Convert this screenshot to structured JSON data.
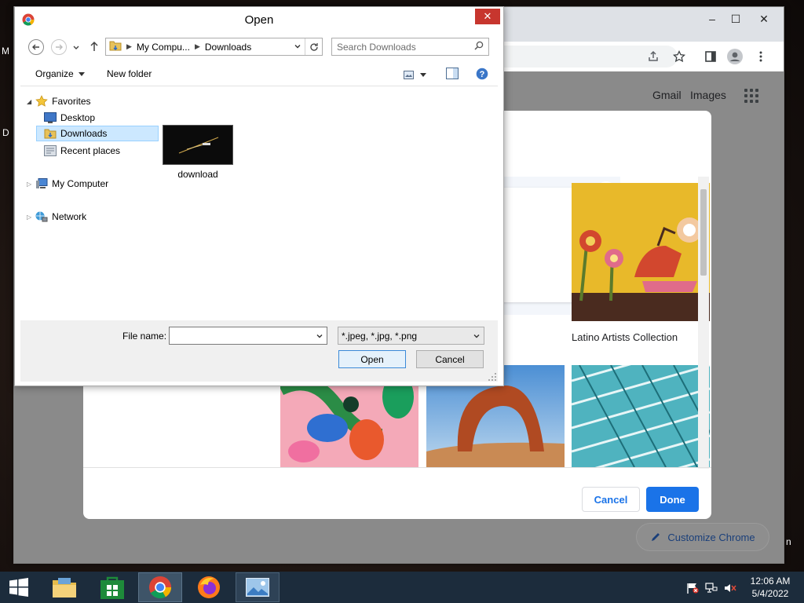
{
  "desktop": {
    "edge_letter_top": "M",
    "edge_letter_mid": "D",
    "edge_letter_right": "n"
  },
  "chrome": {
    "controls": {
      "minimize": "–",
      "maximize": "☐",
      "close": "✕"
    },
    "toolbar_icons": [
      "share-icon",
      "star-icon",
      "side-panel-icon",
      "profile-icon",
      "menu-icon"
    ],
    "ntp": {
      "gmail_link": "Gmail",
      "images_link": "Images",
      "customize_chrome": "Customize Chrome"
    },
    "customize_dialog": {
      "tiles": [
        {
          "caption": ""
        },
        {
          "caption": "Latino Artists Collection"
        }
      ],
      "cancel_button": "Cancel",
      "done_button": "Done",
      "accent_color": "#1a73e8"
    }
  },
  "open_dialog": {
    "title": "Open",
    "close_glyph": "✕",
    "address": {
      "segment_1": "My Compu...",
      "segment_2": "Downloads"
    },
    "search_placeholder": "Search Downloads",
    "commands": {
      "organize": "Organize",
      "new_folder": "New folder"
    },
    "tree": {
      "favorites": "Favorites",
      "desktop": "Desktop",
      "downloads": "Downloads",
      "recent_places": "Recent places",
      "my_computer": "My Computer",
      "network": "Network"
    },
    "files": [
      {
        "name": "download"
      }
    ],
    "file_name_label": "File name:",
    "file_name_value": "",
    "file_type_value": "*.jpeg, *.jpg, *.png",
    "open_button": "Open",
    "cancel_button": "Cancel"
  },
  "taskbar": {
    "apps": [
      "start-icon",
      "file-explorer-icon",
      "store-icon",
      "chrome-icon",
      "firefox-icon",
      "photos-icon"
    ],
    "clock_time": "12:06 AM",
    "clock_date": "5/4/2022"
  }
}
